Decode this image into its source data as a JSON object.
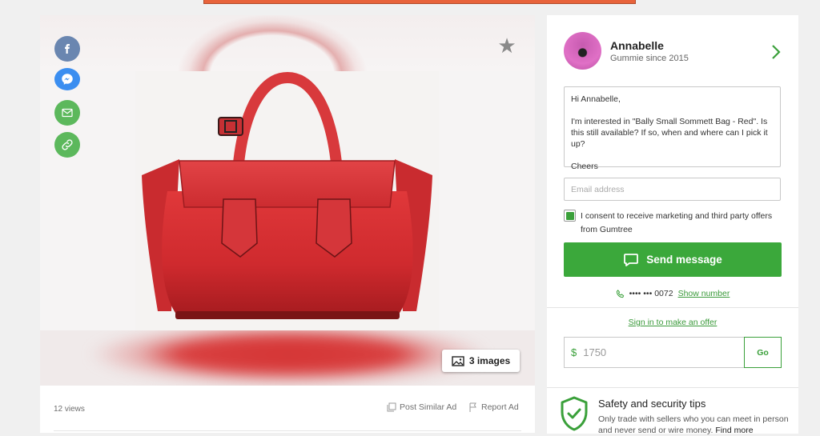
{
  "colors": {
    "brand_green": "#3ba83b",
    "facebook": "#6a86b0",
    "messenger": "#3b8ef0",
    "share_green": "#5cb85c",
    "header_orange": "#e8633b"
  },
  "gallery": {
    "share_icons": [
      "facebook-icon",
      "messenger-icon",
      "mail-icon",
      "link-icon"
    ],
    "favorite_icon": "star-icon",
    "images_button_label": "3 images",
    "views": "12 views",
    "post_similar_label": "Post Similar Ad",
    "report_label": "Report Ad"
  },
  "seller": {
    "name": "Annabelle",
    "since": "Gummie since 2015"
  },
  "message": {
    "greeting": "Hi Annabelle,",
    "body": "I'm interested in \"Bally Small Sommett Bag - Red\". Is this still available? If so, when and where can I pick it up?",
    "signoff": "Cheers"
  },
  "email": {
    "placeholder": "Email address"
  },
  "consent": {
    "label": "I consent to receive marketing and third party offers from Gumtree",
    "checked": true
  },
  "send_button_label": "Send message",
  "phone": {
    "masked": "•••• ••• 0072",
    "show_label": "Show number"
  },
  "offer": {
    "sign_in_label": "Sign in to make an offer",
    "currency": "$",
    "value": "1750",
    "go_label": "Go"
  },
  "safety": {
    "title": "Safety and security tips",
    "text": "Only trade with sellers who you can meet in person and never send or wire money.",
    "more_label": "Find more"
  }
}
